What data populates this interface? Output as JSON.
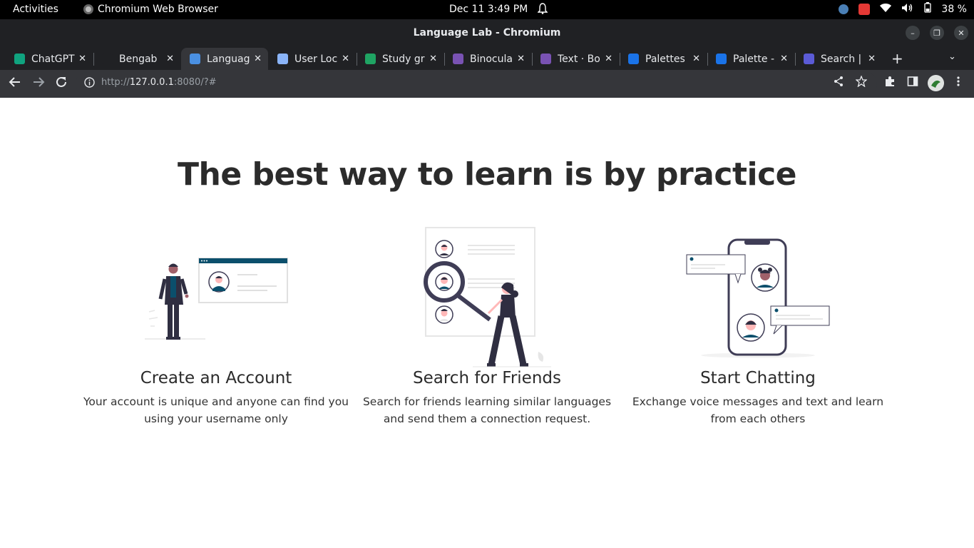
{
  "system_bar": {
    "activities": "Activities",
    "app_name": "Chromium Web Browser",
    "clock": "Dec 11  3:49 PM",
    "battery": "38 %"
  },
  "window": {
    "title": "Language Lab - Chromium"
  },
  "tabs": [
    {
      "label": "ChatGPT",
      "favicon_color": "#10a37f",
      "active": false
    },
    {
      "label": "Bengab",
      "favicon_color": "#202124",
      "active": false
    },
    {
      "label": "Languag",
      "favicon_color": "#4a90e2",
      "active": true
    },
    {
      "label": "User Loc",
      "favicon_color": "#8ab4f8",
      "active": false
    },
    {
      "label": "Study gr",
      "favicon_color": "#1fa463",
      "active": false
    },
    {
      "label": "Binocula",
      "favicon_color": "#7952b3",
      "active": false
    },
    {
      "label": "Text · Bo",
      "favicon_color": "#7952b3",
      "active": false
    },
    {
      "label": "Palettes",
      "favicon_color": "#1a73e8",
      "active": false
    },
    {
      "label": "Palette -",
      "favicon_color": "#1a73e8",
      "active": false
    },
    {
      "label": "Search |",
      "favicon_color": "#5b5bd6",
      "active": false
    }
  ],
  "toolbar": {
    "url_prefix": "http://",
    "url_host": "127.0.0.1",
    "url_rest": ":8080/?#"
  },
  "page": {
    "headline": "The best way to learn is by practice",
    "features": [
      {
        "title": "Create an Account",
        "description": "Your account is unique and anyone can find you using your username only"
      },
      {
        "title": "Search for Friends",
        "description": "Search for friends learning similar languages and send them a connection request."
      },
      {
        "title": "Start Chatting",
        "description": "Exchange voice messages and text and learn from each others"
      }
    ]
  },
  "colors": {
    "accent": "#0b4f6c",
    "ink": "#2f2e41",
    "skin": "#ffb8b8",
    "browser_dark": "#202124"
  }
}
